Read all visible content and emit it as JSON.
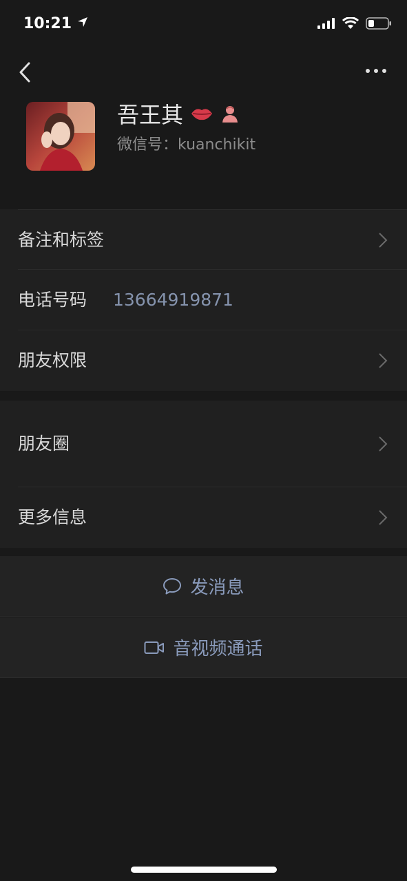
{
  "status_bar": {
    "time": "10:21",
    "icons": [
      "location-arrow-icon",
      "signal-icon",
      "wifi-icon",
      "battery-icon"
    ]
  },
  "nav": {
    "back_icon": "chevron-left-icon",
    "more_icon": "more-dots-icon"
  },
  "profile": {
    "name": "吾王其",
    "name_emojis": [
      "lips-emoji",
      "woman-emoji"
    ],
    "wechat_id_label": "微信号：",
    "wechat_id": "kuanchikit"
  },
  "section1": {
    "rows": [
      {
        "label": "备注和标签",
        "has_chevron": true
      },
      {
        "label": "电话号码",
        "value": "13664919871",
        "has_chevron": false
      },
      {
        "label": "朋友权限",
        "has_chevron": true
      }
    ]
  },
  "section2": {
    "rows": [
      {
        "label": "朋友圈",
        "has_chevron": true
      },
      {
        "label": "更多信息",
        "has_chevron": true
      }
    ]
  },
  "actions": {
    "send_message": "发消息",
    "video_call": "音视频通话"
  },
  "colors": {
    "background": "#191919",
    "cell": "#202020",
    "link": "#8a9bbc"
  }
}
